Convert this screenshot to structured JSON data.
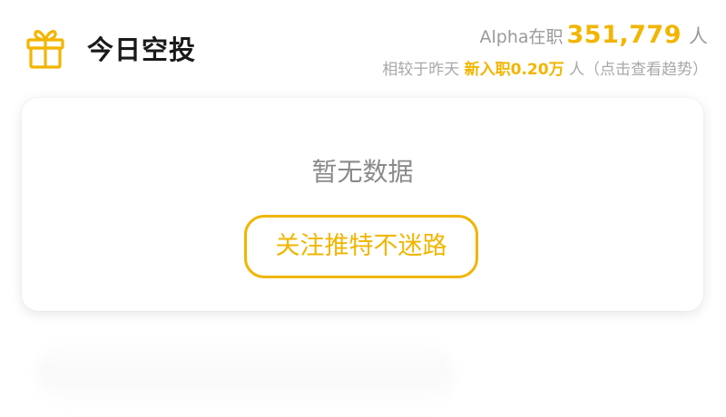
{
  "header": {
    "title": "今日空投",
    "gift_icon": "gift-icon",
    "accent_color": "#f2b500"
  },
  "stats": {
    "prefix": "Alpha在职",
    "count": "351,779",
    "unit": "人",
    "compare_prefix": "相较于昨天",
    "new_label": "新入职",
    "new_value": "0.20万",
    "compare_suffix": "人（点击查看趋势）"
  },
  "card": {
    "empty_text": "暂无数据",
    "follow_button_label": "关注推特不迷路"
  }
}
